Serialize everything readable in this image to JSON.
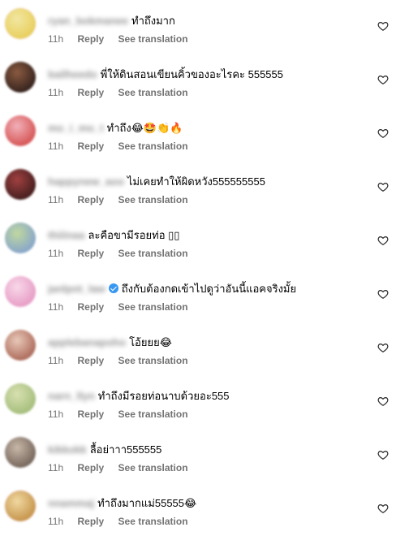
{
  "comments": [
    {
      "username": "ryan_bokmanee",
      "verified": false,
      "text": "ทำถึงมาก",
      "time": "11h",
      "reply": "Reply",
      "translate": "See translation",
      "avatar_colors": [
        "#e8d060",
        "#f2e7a2"
      ],
      "avatar_ring": "#e06fb8"
    },
    {
      "username": "bailheedo",
      "verified": false,
      "text": "พี่ให้ดินสอนเขียนคิ้วของอะไรคะ 555555",
      "time": "11h",
      "reply": "Reply",
      "translate": "See translation",
      "avatar_colors": [
        "#3a2620",
        "#8a5a40"
      ],
      "avatar_ring": "#3a2620"
    },
    {
      "username": "mo_i_mo_t",
      "verified": false,
      "text": "ทำถึง😂🤩👏🔥",
      "time": "11h",
      "reply": "Reply",
      "translate": "See translation",
      "avatar_colors": [
        "#d85a5a",
        "#f0b0b8"
      ],
      "avatar_ring": "#f0a0c8"
    },
    {
      "username": "happynew_aoo",
      "verified": false,
      "text": "ไม่เคยทำให้ผิดหวัง555555555",
      "time": "11h",
      "reply": "Reply",
      "translate": "See translation",
      "avatar_colors": [
        "#4a2020",
        "#a04040"
      ],
      "avatar_ring": "#6a2a2a"
    },
    {
      "username": "thiiinaa",
      "verified": false,
      "text": "ละคือขามีรอยท่อ ▯▯",
      "time": "11h",
      "reply": "Reply",
      "translate": "See translation",
      "avatar_colors": [
        "#8aa8c8",
        "#c0d8a0"
      ],
      "avatar_ring": "#a8c0d8"
    },
    {
      "username": "janlpnt_law",
      "verified": true,
      "text": "ถึงกับต้องกดเข้าไปดูว่าอันนี้แอคจริงมั้ย",
      "time": "11h",
      "reply": "Reply",
      "translate": "See translation",
      "avatar_colors": [
        "#e8a0c8",
        "#f8d8e8"
      ],
      "avatar_ring": "#e890c0"
    },
    {
      "username": "applebanapoho",
      "verified": false,
      "text": "โอ้ยยย😂",
      "time": "11h",
      "reply": "Reply",
      "translate": "See translation",
      "avatar_colors": [
        "#b07060",
        "#e8c8b8"
      ],
      "avatar_ring": "#c8a090"
    },
    {
      "username": "narn_llyn",
      "verified": false,
      "text": "ทำถึงมีรอยท่อนาบด้วยอะ555",
      "time": "11h",
      "reply": "Reply",
      "translate": "See translation",
      "avatar_colors": [
        "#a8c080",
        "#d8e0b0"
      ],
      "avatar_ring": "#b8c890"
    },
    {
      "username": "kikkokk",
      "verified": false,
      "text": "ลื้อย่าาา555555",
      "time": "11h",
      "reply": "Reply",
      "translate": "See translation",
      "avatar_colors": [
        "#7a6a60",
        "#c8b8a8"
      ],
      "avatar_ring": "#9a8a80"
    },
    {
      "username": "nnammaj",
      "verified": false,
      "text": "ทำถึงมากแม่55555😂",
      "time": "11h",
      "reply": "Reply",
      "translate": "See translation",
      "avatar_colors": [
        "#c89850",
        "#f0d8a0"
      ],
      "avatar_ring": "#e070b0"
    }
  ],
  "icons": {
    "like": "heart-icon"
  },
  "colors": {
    "meta_text": "#737373",
    "heart_stroke": "#262626",
    "verified": "#3897f0"
  }
}
